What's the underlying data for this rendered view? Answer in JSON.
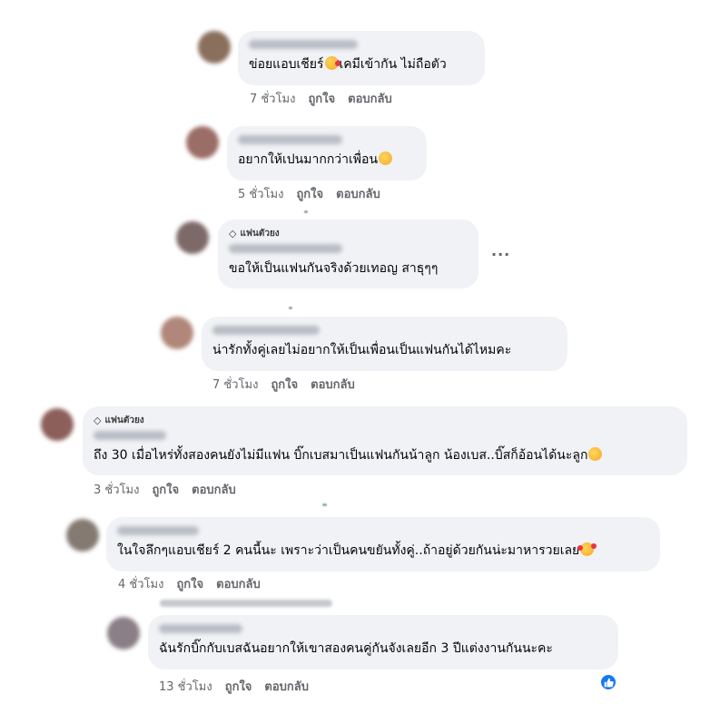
{
  "comments": [
    {
      "text": "ข่อยแอบเชียร์",
      "text2": "เคมีเข้ากัน ไม่ถือตัว",
      "time": "7 ชั่วโมง",
      "like": "ถูกใจ",
      "reply": "ตอบกลับ",
      "avatar_color": "#8a6f5c"
    },
    {
      "text": "อยากให้เปนมากกว่าเพื่อน",
      "time": "5 ชั่วโมง",
      "like": "ถูกใจ",
      "reply": "ตอบกลับ",
      "avatar_color": "#9b6d67"
    },
    {
      "badge": "แฟนตัวยง",
      "text": "ขอให้เป็นแฟนกันจริงด้วยเทอญ สาธุๆๆ",
      "more": "···",
      "avatar_color": "#7d6a68"
    },
    {
      "text": "น่ารักทั้งคู่เลยไม่อยากให้เป็นเพื่อนเป็นแฟนกันได้ไหมคะ",
      "time": "7 ชั่วโมง",
      "like": "ถูกใจ",
      "reply": "ตอบกลับ",
      "avatar_color": "#b0877a"
    },
    {
      "badge": "แฟนตัวยง",
      "text": "ถึง 30 เมื่อไหร่ทั้งสองคนยังไม่มีแฟน บิ๊กเบสมาเป็นแฟนกันน้าลูก น้องเบส..บิ๊สก็อ้อนได้นะลูก",
      "time": "3 ชั่วโมง",
      "like": "ถูกใจ",
      "reply": "ตอบกลับ",
      "avatar_color": "#8c5f5a"
    },
    {
      "text": "ในใจลึกๆแอบเชียร์ 2 คนนี้นะ เพราะว่าเป็นคนขยันทั้งคู่..ถ้าอยู่ด้วยกันน่ะมาหารวยเลย",
      "time": "4 ชั่วโมง",
      "like": "ถูกใจ",
      "reply": "ตอบกลับ",
      "avatar_color": "#857a72"
    },
    {
      "text": "ฉันรักบิ๊กกับเบสฉันอยากให้เขาสองคนคู่กันจังเลยอีก 3 ปีแต่งงานกันนะคะ",
      "time": "13 ชั่วโมง",
      "like": "ถูกใจ",
      "reply": "ตอบกลับ",
      "avatar_color": "#8a7f86"
    }
  ],
  "colors": {
    "bubble": "#f0f2f5",
    "meta": "#65676b",
    "like_icon": "#1877f2"
  },
  "icons": {
    "badge": "diamond-icon",
    "reaction": "thumbs-up-icon",
    "more": "more-options-icon"
  }
}
